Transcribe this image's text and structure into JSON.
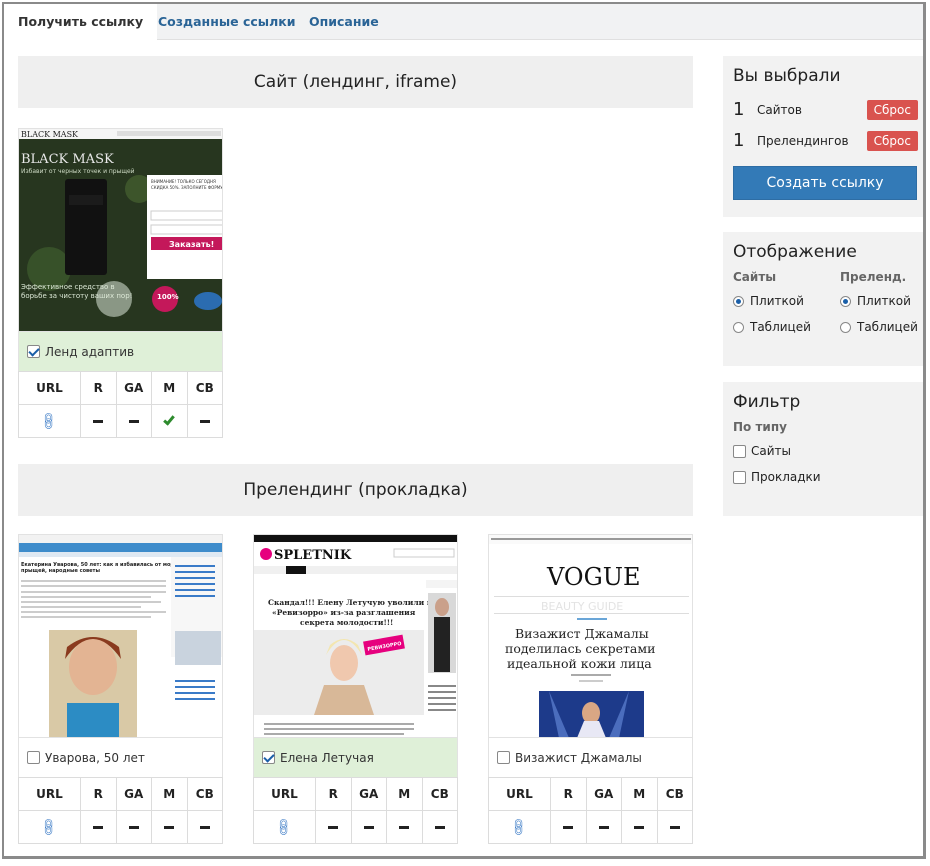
{
  "tabs": [
    {
      "label": "Получить ссылку"
    },
    {
      "label": "Созданные ссылки"
    },
    {
      "label": "Описание"
    }
  ],
  "sections": {
    "sites": {
      "title": "Сайт (лендинг, iframe)"
    },
    "prelandings": {
      "title": "Прелендинг (прокладка)"
    }
  },
  "metric_headers": [
    "URL",
    "R",
    "GA",
    "M",
    "CB"
  ],
  "site_cards": [
    {
      "name": "Ленд адаптив",
      "selected": true,
      "thumb": {
        "brand": "BLACK MASK",
        "headline": "BLACK MASK",
        "tagline": "Избавит от черных точек и прыщей",
        "bottom": "Эффективное средство в борьбе за чистоту ваших пор!",
        "button": "Заказать!",
        "form_note": "ВНИМАНИЕ! ТОЛЬКО СЕГОДНЯ - СКИДКА 50%. ЗАПОЛНИТЕ ФОРМУ И НАЖМИТЕ \"ЗАКАЗАТЬ\" ЗА 1 РУБЛЬ",
        "badge": "100%"
      },
      "metrics": [
        "link",
        "dash",
        "dash",
        "check",
        "dash"
      ]
    }
  ],
  "prelanding_cards": [
    {
      "name": "Уварова, 50 лет",
      "selected": false,
      "thumb": {
        "title": "Екатерина Уварова, 50 лет: как я избавилась от морщин и прыщей, народные советы"
      },
      "metrics": [
        "link",
        "dash",
        "dash",
        "dash",
        "dash"
      ]
    },
    {
      "name": "Елена Летучая",
      "selected": true,
      "thumb": {
        "logo": "SPLETNIK",
        "title": "Скандал!!! Елену Летучую уволили из «Ревизорро» из-за разглашения секрета молодости!!!",
        "badge": "РЕВИЗОРРО"
      },
      "metrics": [
        "link",
        "dash",
        "dash",
        "dash",
        "dash"
      ]
    },
    {
      "name": "Визажист Джамалы",
      "selected": false,
      "thumb": {
        "logo": "VOGUE",
        "sub": "BEAUTY GUIDE",
        "title": "Визажист Джамалы поделилась секретами идеальной кожи лица"
      },
      "metrics": [
        "link",
        "dash",
        "dash",
        "dash",
        "dash"
      ]
    }
  ],
  "sidebar": {
    "selected": {
      "title": "Вы выбрали",
      "rows": [
        {
          "count": "1",
          "label": "Сайтов",
          "reset": "Сброс"
        },
        {
          "count": "1",
          "label": "Прелендингов",
          "reset": "Сброс"
        }
      ],
      "create_button": "Создать ссылку"
    },
    "display": {
      "title": "Отображение",
      "col1": {
        "heading": "Сайты",
        "options": [
          {
            "label": "Плиткой",
            "checked": true
          },
          {
            "label": "Таблицей",
            "checked": false
          }
        ]
      },
      "col2": {
        "heading": "Преленд.",
        "options": [
          {
            "label": "Плиткой",
            "checked": true
          },
          {
            "label": "Таблицей",
            "checked": false
          }
        ]
      }
    },
    "filter": {
      "title": "Фильтр",
      "heading": "По типу",
      "options": [
        {
          "label": "Сайты",
          "checked": false
        },
        {
          "label": "Прокладки",
          "checked": false
        }
      ]
    }
  },
  "colors": {
    "accent": "#337ab7",
    "danger": "#d9534f",
    "selected_bg": "#dff0d8",
    "link": "#2a6496"
  }
}
